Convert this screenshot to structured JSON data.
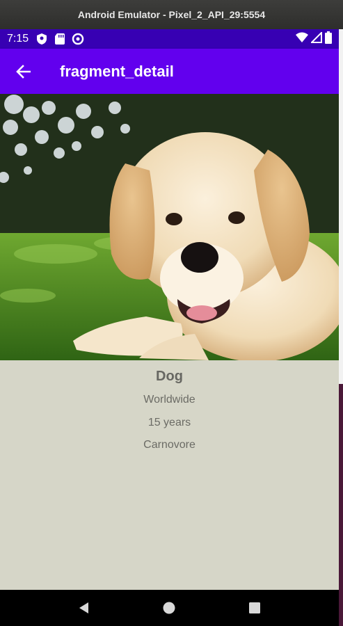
{
  "window": {
    "title": "Android Emulator - Pixel_2_API_29:5554"
  },
  "status_bar": {
    "time": "7:15",
    "left_icons": [
      "shield-icon",
      "sd-card-icon",
      "data-saver-icon"
    ],
    "right_icons": [
      "wifi-icon",
      "cell-signal-icon",
      "battery-icon"
    ]
  },
  "app_bar": {
    "title": "fragment_detail",
    "back_icon": "arrow-back-icon"
  },
  "animal": {
    "image": "puppy-photo",
    "name": "Dog",
    "location": "Worldwide",
    "lifespan": "15 years",
    "diet": "Carnovore"
  },
  "nav_bar": {
    "buttons": [
      "back-triangle-icon",
      "home-circle-icon",
      "recents-square-icon"
    ]
  },
  "colors": {
    "status_bar": "#3700b3",
    "app_bar": "#6200ee",
    "content_bg": "#d6d6c8",
    "detail_text": "#6b6b65"
  }
}
